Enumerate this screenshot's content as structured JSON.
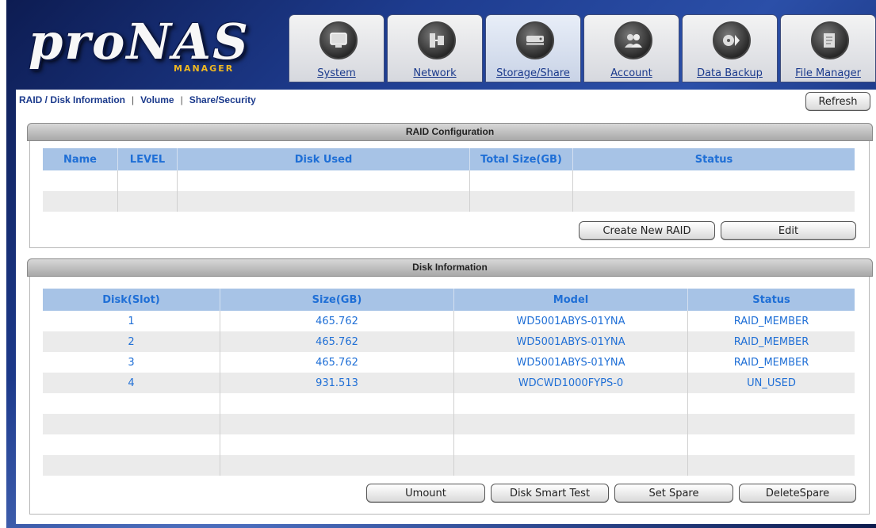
{
  "logo": {
    "main": "proNAS",
    "sub": "MANAGER"
  },
  "tabs": [
    {
      "label": "System",
      "icon": "computer-icon"
    },
    {
      "label": "Network",
      "icon": "network-icon"
    },
    {
      "label": "Storage/Share",
      "icon": "storage-icon"
    },
    {
      "label": "Account",
      "icon": "users-icon"
    },
    {
      "label": "Data Backup",
      "icon": "backup-icon"
    },
    {
      "label": "File Manager",
      "icon": "file-manager-icon"
    }
  ],
  "active_tab": "Storage/Share",
  "subnav": {
    "items": [
      "RAID / Disk Information",
      "Volume",
      "Share/Security"
    ],
    "separator": "|"
  },
  "refresh_label": "Refresh",
  "raid": {
    "title": "RAID Configuration",
    "columns": [
      "Name",
      "LEVEL",
      "Disk Used",
      "Total Size(GB)",
      "Status"
    ],
    "rows": [
      [
        "",
        "",
        "",
        "",
        ""
      ],
      [
        "",
        "",
        "",
        "",
        ""
      ]
    ],
    "buttons": {
      "create": "Create New RAID",
      "edit": "Edit"
    }
  },
  "disk": {
    "title": "Disk Information",
    "columns": [
      "Disk(Slot)",
      "Size(GB)",
      "Model",
      "Status"
    ],
    "rows": [
      [
        "1",
        "465.762",
        "WD5001ABYS-01YNA",
        "RAID_MEMBER"
      ],
      [
        "2",
        "465.762",
        "WD5001ABYS-01YNA",
        "RAID_MEMBER"
      ],
      [
        "3",
        "465.762",
        "WD5001ABYS-01YNA",
        "RAID_MEMBER"
      ],
      [
        "4",
        "931.513",
        "WDCWD1000FYPS-0",
        "UN_USED"
      ],
      [
        "",
        "",
        "",
        ""
      ],
      [
        "",
        "",
        "",
        ""
      ],
      [
        "",
        "",
        "",
        ""
      ],
      [
        "",
        "",
        "",
        ""
      ]
    ],
    "buttons": {
      "umount": "Umount",
      "smart": "Disk Smart Test",
      "set_spare": "Set Spare",
      "delete_spare": "DeleteSpare"
    }
  },
  "colors": {
    "frame": "#1e3c8f",
    "header_blue": "#a7c3e6",
    "text_blue": "#1f6fd6",
    "logo_gold": "#f0b820"
  }
}
